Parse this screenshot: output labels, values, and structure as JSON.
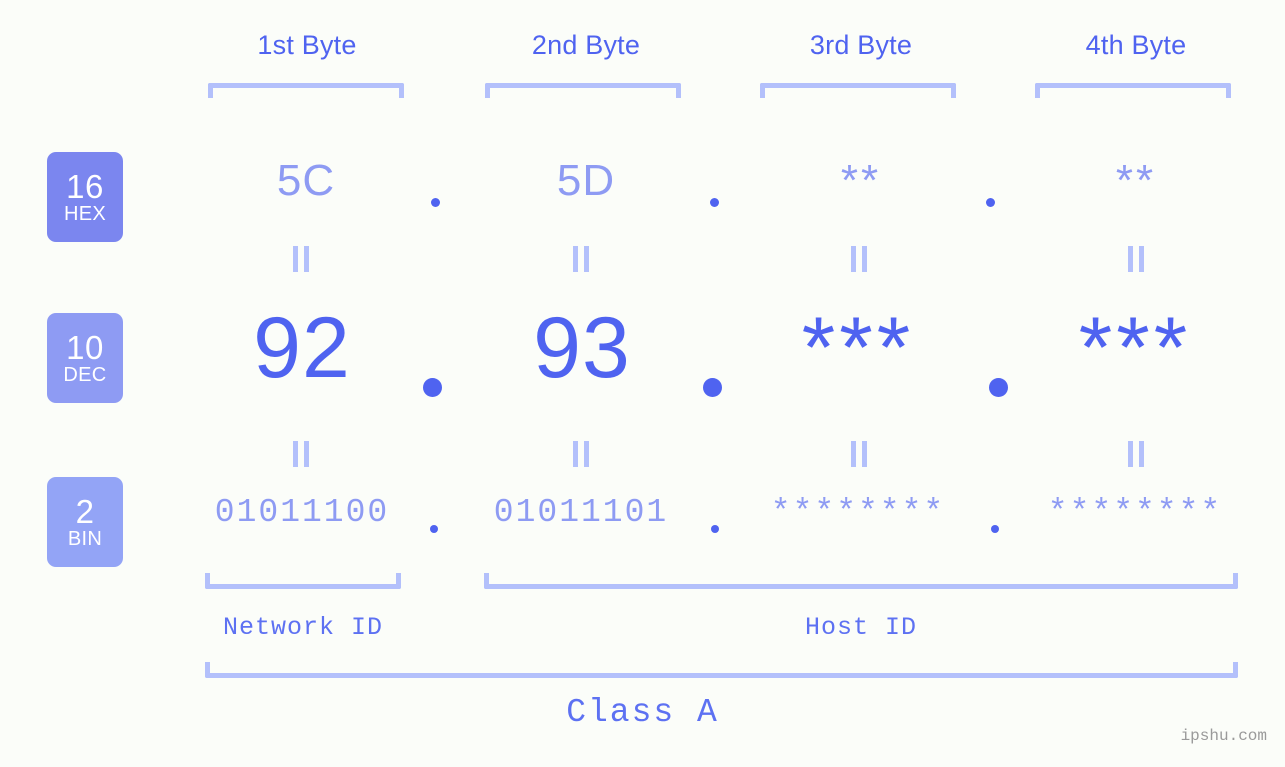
{
  "meta": {
    "background_color": "#fbfdf9",
    "accent_strong": "#4f63f0",
    "accent_mid": "#8e9bf3",
    "accent_light": "#b3c0fb",
    "watermark": "ipshu.com"
  },
  "byte_headers": [
    {
      "label": "1st Byte"
    },
    {
      "label": "2nd Byte"
    },
    {
      "label": "3rd Byte"
    },
    {
      "label": "4th Byte"
    }
  ],
  "bases": [
    {
      "number": "16",
      "name": "HEX",
      "color": "#7b86ef"
    },
    {
      "number": "10",
      "name": "DEC",
      "color": "#8e9bf3"
    },
    {
      "number": "2",
      "name": "BIN",
      "color": "#93a4f6"
    }
  ],
  "rows": {
    "hex": {
      "values": [
        "5C",
        "5D",
        "**",
        "**"
      ],
      "separator": "."
    },
    "dec": {
      "values": [
        "92",
        "93",
        "***",
        "***"
      ],
      "separator": "."
    },
    "bin": {
      "values": [
        "01011100",
        "01011101",
        "********",
        "********"
      ],
      "separator": "."
    }
  },
  "connectors": {
    "symbol": "||"
  },
  "segments": [
    {
      "label": "Network ID"
    },
    {
      "label": "Host ID"
    }
  ],
  "class": {
    "label": "Class A"
  }
}
